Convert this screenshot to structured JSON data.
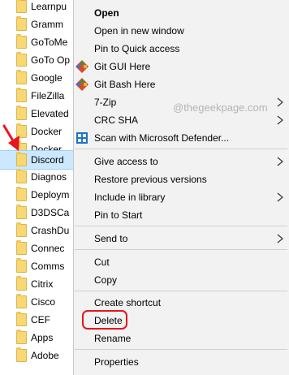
{
  "folders": [
    {
      "name": "Learnpu",
      "selected": false
    },
    {
      "name": "Gramm",
      "selected": false
    },
    {
      "name": "GoToMe",
      "selected": false
    },
    {
      "name": "GoTo Op",
      "selected": false
    },
    {
      "name": "Google",
      "selected": false
    },
    {
      "name": "FileZilla",
      "selected": false
    },
    {
      "name": "Elevated",
      "selected": false
    },
    {
      "name": "Docker",
      "selected": false
    },
    {
      "name": "Docker",
      "selected": false
    },
    {
      "name": "Discord",
      "selected": true
    },
    {
      "name": "Diagnos",
      "selected": false
    },
    {
      "name": "Deploym",
      "selected": false
    },
    {
      "name": "D3DSCa",
      "selected": false
    },
    {
      "name": "CrashDu",
      "selected": false
    },
    {
      "name": "Connec",
      "selected": false
    },
    {
      "name": "Comms",
      "selected": false
    },
    {
      "name": "Citrix",
      "selected": false
    },
    {
      "name": "Cisco",
      "selected": false
    },
    {
      "name": "CEF",
      "selected": false
    },
    {
      "name": "Apps",
      "selected": false
    },
    {
      "name": "Adobe",
      "selected": false
    }
  ],
  "menu": {
    "open": "Open",
    "open_new_window": "Open in new window",
    "pin_quick_access": "Pin to Quick access",
    "git_gui": "Git GUI Here",
    "git_bash": "Git Bash Here",
    "seven_zip": "7-Zip",
    "crc_sha": "CRC SHA",
    "scan_defender": "Scan with Microsoft Defender...",
    "give_access": "Give access to",
    "restore_versions": "Restore previous versions",
    "include_library": "Include in library",
    "pin_start": "Pin to Start",
    "send_to": "Send to",
    "cut": "Cut",
    "copy": "Copy",
    "create_shortcut": "Create shortcut",
    "delete": "Delete",
    "rename": "Rename",
    "properties": "Properties"
  },
  "watermark": "@thegeekpage.com",
  "colors": {
    "menu_bg": "#f2f2f2",
    "highlight_ring": "#e8151b",
    "arrow": "#e8151b",
    "folder": "#f8d775",
    "defender_blue": "#1a73c9"
  }
}
